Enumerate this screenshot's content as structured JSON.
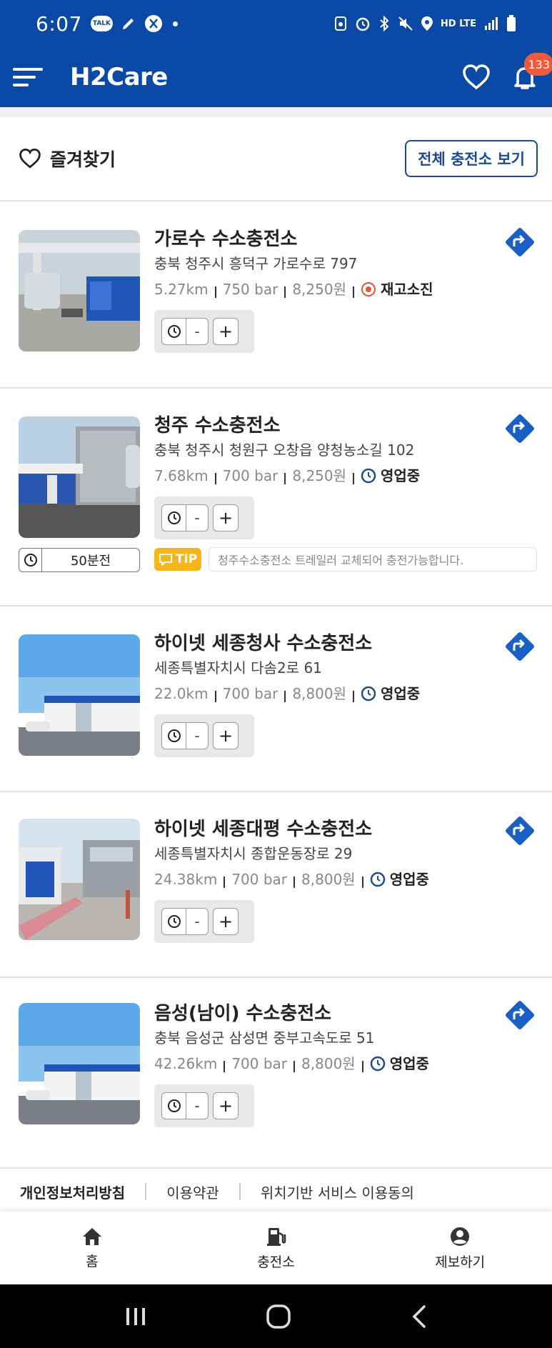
{
  "status_bar": {
    "time": "6:07",
    "talk_badge": "TALK",
    "network": "HD LTE"
  },
  "header": {
    "logo": "H2Care",
    "notification_count": "133"
  },
  "favorites": {
    "title": "즐겨찾기",
    "view_all_label": "전체 충전소 보기"
  },
  "stations": [
    {
      "name": "가로수 수소충전소",
      "address": "충북 청주시 흥덕구 가로수로 797",
      "distance": "5.27km",
      "pressure": "750 bar",
      "price": "8,250원",
      "status": "재고소진",
      "status_color": "#e8553a",
      "minus": "-",
      "plus": "+"
    },
    {
      "name": "청주 수소충전소",
      "address": "충북 청주시 청원구 오창읍 양청농소길 102",
      "distance": "7.68km",
      "pressure": "700 bar",
      "price": "8,250원",
      "status": "영업중",
      "status_color": "#1a4d8f",
      "minus": "-",
      "plus": "+",
      "wait": "50분전",
      "tip_label": "TIP",
      "tip_text": "청주수소충전소 트레일러 교체되어 충전가능합니다."
    },
    {
      "name": "하이넷 세종청사 수소충전소",
      "address": "세종특별자치시 다솜2로 61",
      "distance": "22.0km",
      "pressure": "700 bar",
      "price": "8,800원",
      "status": "영업중",
      "status_color": "#1a4d8f",
      "minus": "-",
      "plus": "+"
    },
    {
      "name": "하이넷 세종대평 수소충전소",
      "address": "세종특별자치시 종합운동장로 29",
      "distance": "24.38km",
      "pressure": "700 bar",
      "price": "8,800원",
      "status": "영업중",
      "status_color": "#1a4d8f",
      "minus": "-",
      "plus": "+"
    },
    {
      "name": "음성(남이) 수소충전소",
      "address": "충북 음성군 삼성면 중부고속도로 51",
      "distance": "42.26km",
      "pressure": "700 bar",
      "price": "8,800원",
      "status": "영업중",
      "status_color": "#1a4d8f",
      "minus": "-",
      "plus": "+"
    }
  ],
  "footer": {
    "privacy": "개인정보처리방침",
    "terms": "이용약관",
    "location": "위치기반 서비스 이용동의"
  },
  "bottom_nav": {
    "home": "홈",
    "stations": "충전소",
    "report": "제보하기"
  },
  "colors": {
    "brand": "#0a4aa6",
    "accent": "#1a4d8f",
    "tip": "#f6b51a",
    "badge": "#f05a3a"
  }
}
